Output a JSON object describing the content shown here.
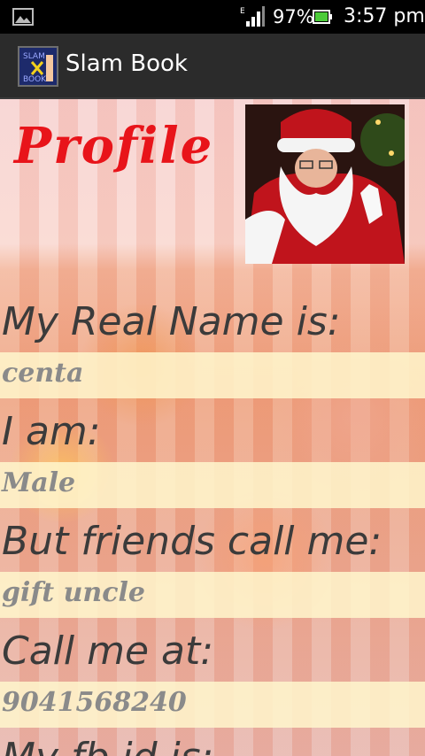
{
  "status_bar": {
    "battery_percent": "97%",
    "time": "3:57 pm",
    "icons": [
      "picture-icon",
      "signal-icon",
      "battery-icon"
    ]
  },
  "action_bar": {
    "title": "Slam Book",
    "icon": "slam-book-app-icon"
  },
  "profile": {
    "heading": "Profile",
    "photo": "santa-profile-photo",
    "fields": [
      {
        "label": "My Real Name is:",
        "value": "centa"
      },
      {
        "label": "I am:",
        "value": "Male"
      },
      {
        "label": "But friends call me:",
        "value": "gift uncle"
      },
      {
        "label": "Call me at:",
        "value": "9041568240"
      },
      {
        "label": "My fb id is:",
        "value": ""
      }
    ]
  },
  "colors": {
    "heading": "#e8141a",
    "label": "#3b3b3b",
    "value": "#8a8a8a",
    "value_band": "#fff7cd",
    "action_bar": "#2b2b2b"
  }
}
